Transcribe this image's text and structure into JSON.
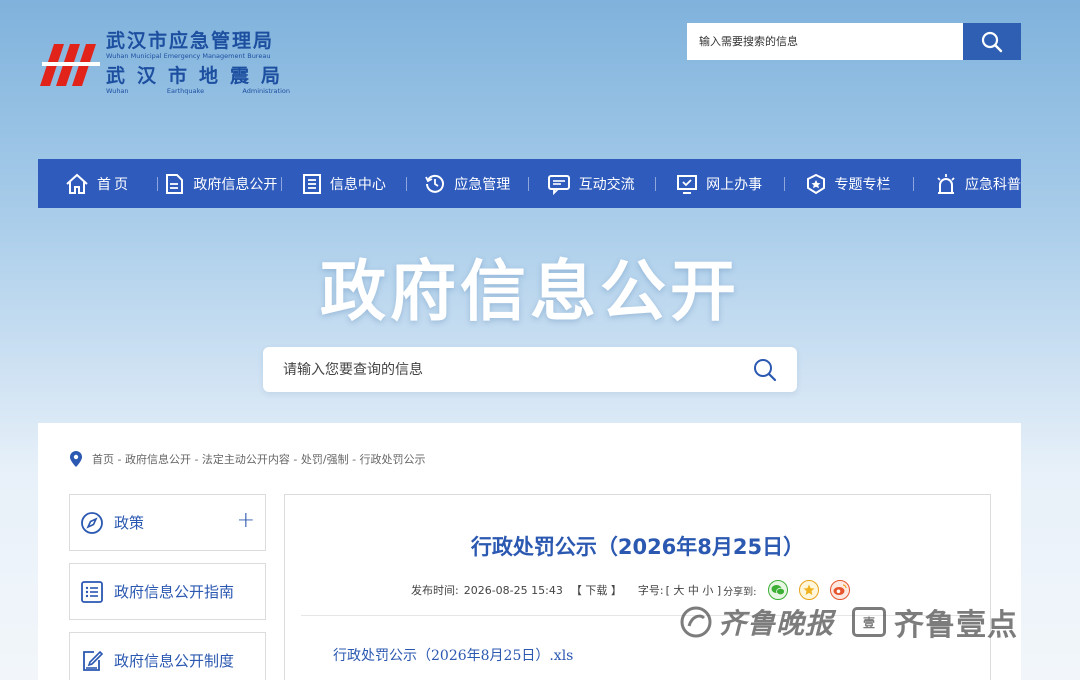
{
  "header": {
    "org_cn_1": "武汉市应急管理局",
    "org_en_1": "Wuhan Municipal Emergency Management Bureau",
    "org_cn_2": "武汉市地震局",
    "org_en_2_parts": [
      "Wuhan",
      "Earthquake",
      "Administration"
    ],
    "search_placeholder": "输入需要搜索的信息"
  },
  "nav": {
    "items": [
      {
        "label": "首页",
        "icon": "home-icon"
      },
      {
        "label": "政府信息公开",
        "icon": "document-icon"
      },
      {
        "label": "信息中心",
        "icon": "list-icon"
      },
      {
        "label": "应急管理",
        "icon": "clock-icon"
      },
      {
        "label": "互动交流",
        "icon": "chat-icon"
      },
      {
        "label": "网上办事",
        "icon": "monitor-icon"
      },
      {
        "label": "专题专栏",
        "icon": "badge-icon"
      },
      {
        "label": "应急科普",
        "icon": "alarm-icon"
      }
    ]
  },
  "hero": {
    "title": "政府信息公开",
    "search_placeholder": "请输入您要查询的信息"
  },
  "breadcrumb": "首页 - 政府信息公开 - 法定主动公开内容 - 处罚/强制 - 行政处罚公示",
  "sidebar": {
    "items": [
      {
        "label": "政策",
        "icon": "compass-icon",
        "expand": "+"
      },
      {
        "label": "政府信息公开指南",
        "icon": "list-icon"
      },
      {
        "label": "政府信息公开制度",
        "icon": "edit-icon"
      }
    ]
  },
  "article": {
    "title": "行政处罚公示（2026年8月25日）",
    "publish_label": "发布时间:",
    "publish_time": "2026-08-25 15:43",
    "download": "【 下载 】",
    "font_label": "字号:",
    "font_sizes": "[ 大 中 小 ]",
    "share_label": "分享到:",
    "attachment": "行政处罚公示（2026年8月25日）.xls"
  },
  "watermark": {
    "text1": "齐鲁晚报",
    "box": "壹",
    "text2": "齐鲁壹点"
  },
  "colors": {
    "brand_blue": "#2f5bbd",
    "link_blue": "#2b58b0",
    "logo_red": "#e2231a"
  }
}
